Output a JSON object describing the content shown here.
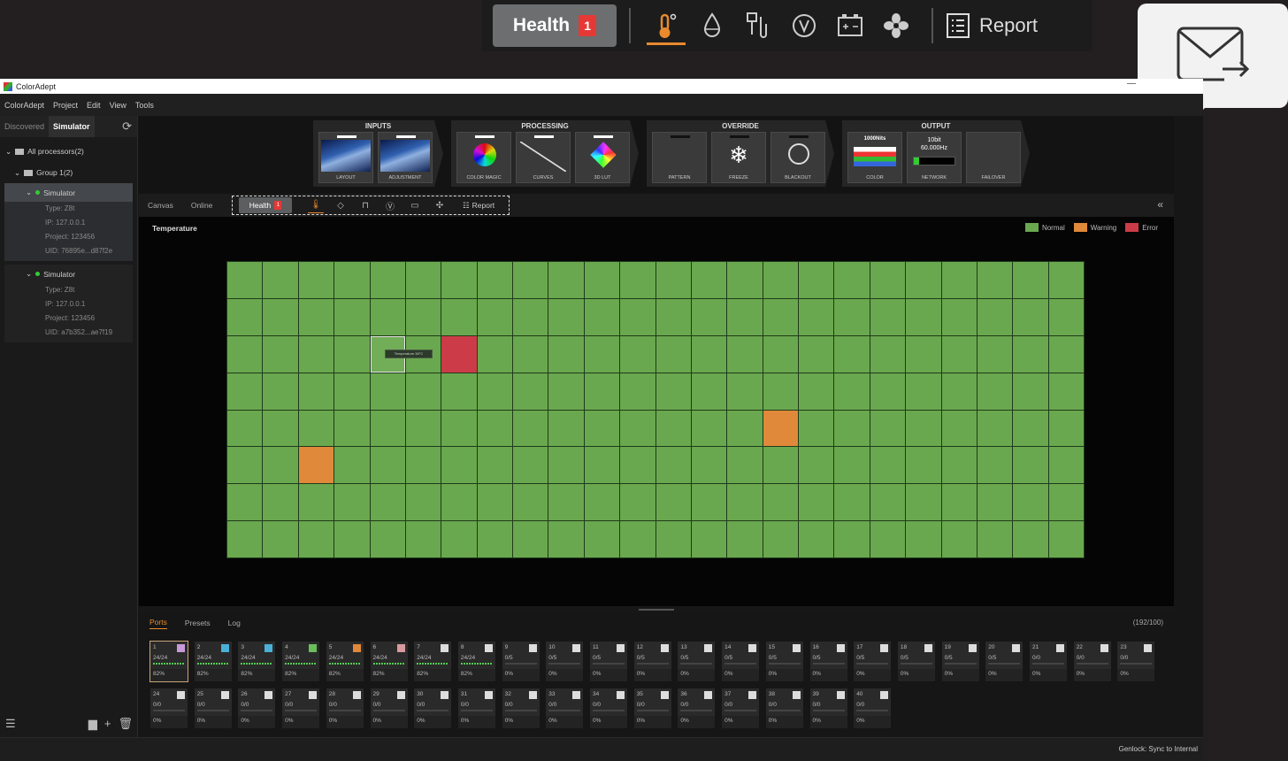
{
  "callout": {
    "health_label": "Health",
    "health_badge": "1",
    "report_label": "Report",
    "icons": [
      "thermometer-icon",
      "drop-icon",
      "plug-icon",
      "voltage-icon",
      "battery-icon",
      "fan-icon"
    ]
  },
  "window": {
    "title": "ColorAdept",
    "menu": [
      "ColorAdept",
      "Project",
      "Edit",
      "View",
      "Tools"
    ]
  },
  "sidebar": {
    "tabs": [
      "Discovered",
      "Simulator"
    ],
    "active_tab": "Simulator",
    "root": "All processors(2)",
    "group": "Group 1(2)",
    "devices": [
      {
        "name": "Simulator",
        "type": "Type: Z8t",
        "ip": "IP: 127.0.0.1",
        "project": "Project: 123456",
        "uid": "UID: 76895e...d87f2e"
      },
      {
        "name": "Simulator",
        "type": "Type: Z8t",
        "ip": "IP: 127.0.0.1",
        "project": "Project: 123456",
        "uid": "UID: a7b352...ae7f19"
      }
    ]
  },
  "pipeline": {
    "groups": [
      {
        "title": "INPUTS",
        "tiles": [
          "LAYOUT",
          "ADJUSTMENT"
        ]
      },
      {
        "title": "PROCESSING",
        "tiles": [
          "COLOR MAGIC",
          "CURVES",
          "3D LUT"
        ]
      },
      {
        "title": "OVERRIDE",
        "tiles": [
          "PATTERN",
          "FREEZE",
          "BLACKOUT"
        ]
      },
      {
        "title": "OUTPUT",
        "tiles": [
          "COLOR",
          "NETWORK",
          "FAILOVER"
        ]
      }
    ],
    "color_nits": "1000Nits",
    "network_bit": "10bit",
    "network_hz": "60.000Hz",
    "freeze_glyph": "❄"
  },
  "subtabs": {
    "canvas": "Canvas",
    "online": "Online",
    "health": "Health",
    "health_badge": "1",
    "report": "Report",
    "collapse": "«"
  },
  "map": {
    "title": "Temperature",
    "legend": [
      {
        "label": "Normal",
        "color": "#6aa84f"
      },
      {
        "label": "Warning",
        "color": "#e0893a"
      },
      {
        "label": "Error",
        "color": "#cc3c48"
      }
    ],
    "rows": 8,
    "cols": 24,
    "warnings": [
      [
        4,
        15
      ],
      [
        5,
        2
      ]
    ],
    "errors": [
      [
        2,
        6
      ]
    ],
    "hover_cell": [
      2,
      4
    ],
    "tooltip": "Temperature 38°C"
  },
  "bottom": {
    "tabs": [
      "Ports",
      "Presets",
      "Log"
    ],
    "active_tab": "Ports",
    "count": "(192/100)",
    "ports": [
      {
        "n": "1",
        "v": "24/24",
        "p": "82%",
        "c": "#c89ad8",
        "on": true
      },
      {
        "n": "2",
        "v": "24/24",
        "p": "82%",
        "c": "#4ab0d8",
        "on": true
      },
      {
        "n": "3",
        "v": "24/24",
        "p": "82%",
        "c": "#4ab0d8",
        "on": true
      },
      {
        "n": "4",
        "v": "24/24",
        "p": "82%",
        "c": "#6abf5a",
        "on": true
      },
      {
        "n": "5",
        "v": "24/24",
        "p": "82%",
        "c": "#e0893a",
        "on": true
      },
      {
        "n": "6",
        "v": "24/24",
        "p": "82%",
        "c": "#d89aa0",
        "on": true
      },
      {
        "n": "7",
        "v": "24/24",
        "p": "82%",
        "c": "#dddddd",
        "on": true
      },
      {
        "n": "8",
        "v": "24/24",
        "p": "82%",
        "c": "#dddddd",
        "on": true
      },
      {
        "n": "9",
        "v": "0/5",
        "p": "0%",
        "c": "#dddddd",
        "on": false
      },
      {
        "n": "10",
        "v": "0/5",
        "p": "0%",
        "c": "#dddddd",
        "on": false
      },
      {
        "n": "11",
        "v": "0/5",
        "p": "0%",
        "c": "#dddddd",
        "on": false
      },
      {
        "n": "12",
        "v": "0/5",
        "p": "0%",
        "c": "#dddddd",
        "on": false
      },
      {
        "n": "13",
        "v": "0/5",
        "p": "0%",
        "c": "#dddddd",
        "on": false
      },
      {
        "n": "14",
        "v": "0/5",
        "p": "0%",
        "c": "#dddddd",
        "on": false
      },
      {
        "n": "15",
        "v": "0/5",
        "p": "0%",
        "c": "#dddddd",
        "on": false
      },
      {
        "n": "16",
        "v": "0/5",
        "p": "0%",
        "c": "#dddddd",
        "on": false
      },
      {
        "n": "17",
        "v": "0/5",
        "p": "0%",
        "c": "#dddddd",
        "on": false
      },
      {
        "n": "18",
        "v": "0/5",
        "p": "0%",
        "c": "#dddddd",
        "on": false
      },
      {
        "n": "19",
        "v": "0/5",
        "p": "0%",
        "c": "#dddddd",
        "on": false
      },
      {
        "n": "20",
        "v": "0/5",
        "p": "0%",
        "c": "#dddddd",
        "on": false
      },
      {
        "n": "21",
        "v": "0/0",
        "p": "0%",
        "c": "#dddddd",
        "on": false
      },
      {
        "n": "22",
        "v": "0/0",
        "p": "0%",
        "c": "#dddddd",
        "on": false
      },
      {
        "n": "23",
        "v": "0/0",
        "p": "0%",
        "c": "#dddddd",
        "on": false
      },
      {
        "n": "24",
        "v": "0/0",
        "p": "0%",
        "c": "#dddddd",
        "on": false
      },
      {
        "n": "25",
        "v": "0/0",
        "p": "0%",
        "c": "#dddddd",
        "on": false
      },
      {
        "n": "26",
        "v": "0/0",
        "p": "0%",
        "c": "#dddddd",
        "on": false
      },
      {
        "n": "27",
        "v": "0/0",
        "p": "0%",
        "c": "#dddddd",
        "on": false
      },
      {
        "n": "28",
        "v": "0/0",
        "p": "0%",
        "c": "#dddddd",
        "on": false
      },
      {
        "n": "29",
        "v": "0/0",
        "p": "0%",
        "c": "#dddddd",
        "on": false
      },
      {
        "n": "30",
        "v": "0/0",
        "p": "0%",
        "c": "#dddddd",
        "on": false
      },
      {
        "n": "31",
        "v": "0/0",
        "p": "0%",
        "c": "#dddddd",
        "on": false
      },
      {
        "n": "32",
        "v": "0/0",
        "p": "0%",
        "c": "#dddddd",
        "on": false
      },
      {
        "n": "33",
        "v": "0/0",
        "p": "0%",
        "c": "#dddddd",
        "on": false
      },
      {
        "n": "34",
        "v": "0/0",
        "p": "0%",
        "c": "#dddddd",
        "on": false
      },
      {
        "n": "35",
        "v": "0/0",
        "p": "0%",
        "c": "#dddddd",
        "on": false
      },
      {
        "n": "36",
        "v": "0/0",
        "p": "0%",
        "c": "#dddddd",
        "on": false
      },
      {
        "n": "37",
        "v": "0/0",
        "p": "0%",
        "c": "#dddddd",
        "on": false
      },
      {
        "n": "38",
        "v": "0/0",
        "p": "0%",
        "c": "#dddddd",
        "on": false
      },
      {
        "n": "39",
        "v": "0/0",
        "p": "0%",
        "c": "#dddddd",
        "on": false
      },
      {
        "n": "40",
        "v": "0/0",
        "p": "0%",
        "c": "#dddddd",
        "on": false
      }
    ]
  },
  "status": {
    "genlock": "Genlock: Sync to Internal"
  }
}
